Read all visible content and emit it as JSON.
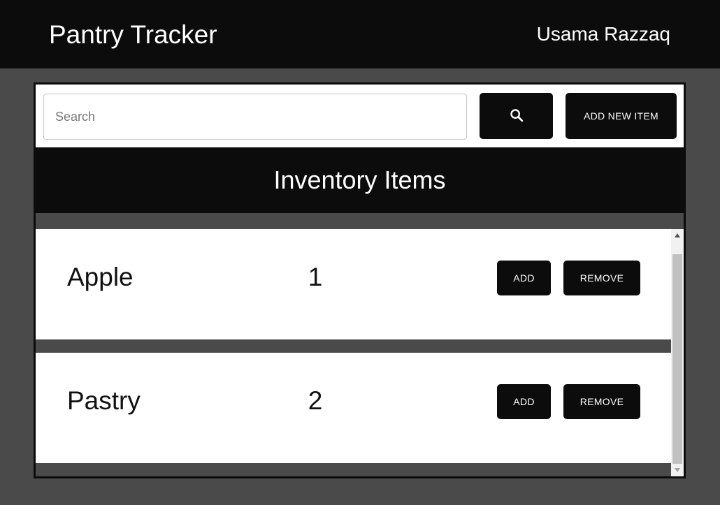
{
  "header": {
    "title": "Pantry Tracker",
    "user": "Usama Razzaq"
  },
  "search": {
    "placeholder": "Search",
    "value": "",
    "button_icon": "search-icon",
    "add_new_label": "ADD NEW ITEM"
  },
  "inventory": {
    "title": "Inventory Items",
    "items": [
      {
        "name": "Apple",
        "quantity": "1",
        "add_label": "ADD",
        "remove_label": "REMOVE"
      },
      {
        "name": "Pastry",
        "quantity": "2",
        "add_label": "ADD",
        "remove_label": "REMOVE"
      }
    ]
  },
  "colors": {
    "bar": "#0c0c0c",
    "background": "#4a4a4a",
    "surface": "#ffffff"
  }
}
